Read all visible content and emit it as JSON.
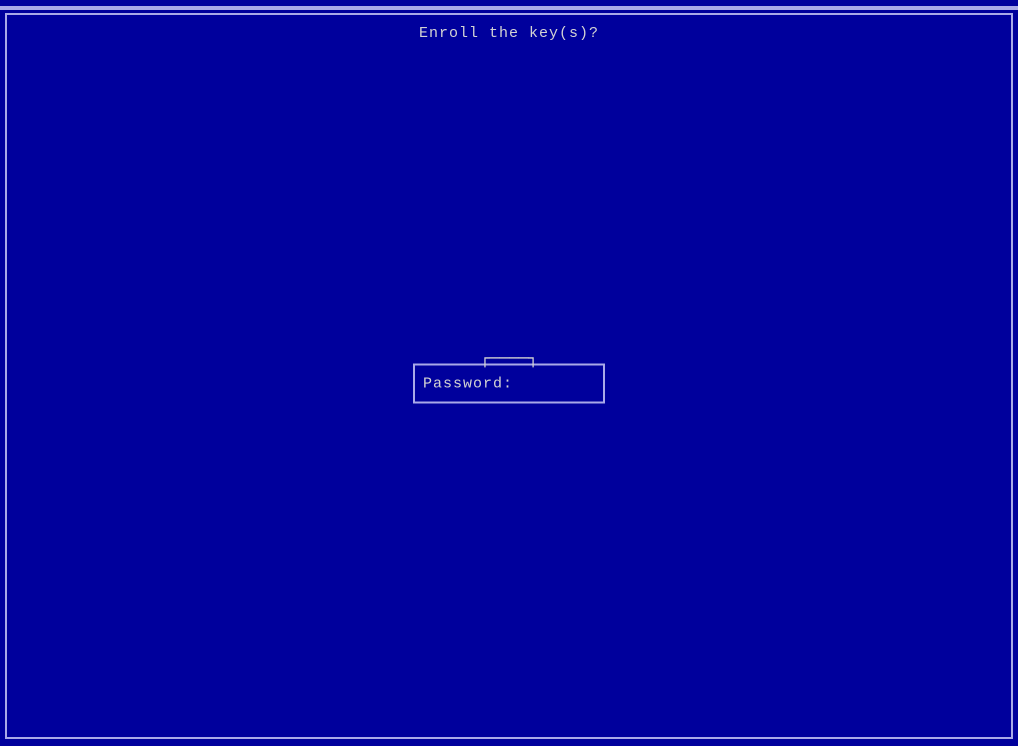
{
  "title": "Enroll the key(s)?",
  "decoration_left": "┌",
  "decoration_line": "────",
  "decoration_right": "┐",
  "password_label": "Password:"
}
